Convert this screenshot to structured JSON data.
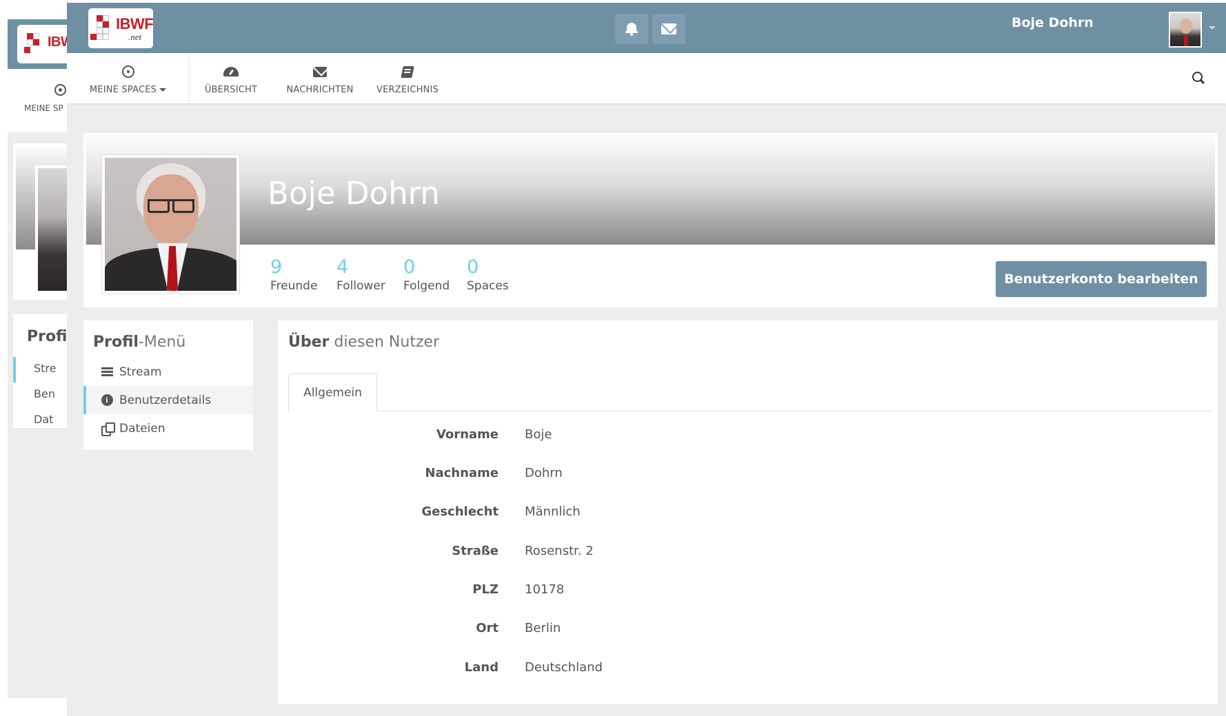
{
  "app": {
    "brand": {
      "logo_text": "IBWF",
      "logo_sub": ".net"
    },
    "colors": {
      "primary": "#6f8fa3",
      "accent": "#6fd1e5",
      "background": "#ededed"
    }
  },
  "ghost_window": {
    "nav_label": "MEINE SP",
    "menu_title": "Profil-",
    "menu_items": [
      "Stre",
      "Ben",
      "Dat"
    ]
  },
  "topbar": {
    "notifications_icon": "bell-icon",
    "messages_icon": "envelope-icon",
    "user_name": "Boje Dohrn"
  },
  "nav": {
    "items": [
      {
        "label": "MEINE SPACES",
        "icon": "target-icon",
        "dropdown": true
      },
      {
        "label": "ÜBERSICHT",
        "icon": "dashboard-icon"
      },
      {
        "label": "NACHRICHTEN",
        "icon": "envelope-icon"
      },
      {
        "label": "VERZEICHNIS",
        "icon": "book-icon"
      }
    ],
    "search_icon": "search-icon"
  },
  "profile": {
    "name": "Boje Dohrn",
    "stats": [
      {
        "value": "9",
        "label": "Freunde"
      },
      {
        "value": "4",
        "label": "Follower"
      },
      {
        "value": "0",
        "label": "Folgend"
      },
      {
        "value": "0",
        "label": "Spaces"
      }
    ],
    "edit_button": "Benutzerkonto bearbeiten"
  },
  "profile_menu": {
    "title_bold": "Profil",
    "title_light": "-Menü",
    "items": [
      {
        "label": "Stream",
        "icon": "bars-icon",
        "active": false
      },
      {
        "label": "Benutzerdetails",
        "icon": "info-icon",
        "active": true
      },
      {
        "label": "Dateien",
        "icon": "files-icon",
        "active": false
      }
    ]
  },
  "about": {
    "title_bold": "Über",
    "title_light": " diesen Nutzer",
    "tab": "Allgemein",
    "fields": [
      {
        "label": "Vorname",
        "value": "Boje"
      },
      {
        "label": "Nachname",
        "value": "Dohrn"
      },
      {
        "label": "Geschlecht",
        "value": "Männlich"
      },
      {
        "label": "Straße",
        "value": "Rosenstr. 2"
      },
      {
        "label": "PLZ",
        "value": "10178"
      },
      {
        "label": "Ort",
        "value": "Berlin"
      },
      {
        "label": "Land",
        "value": "Deutschland"
      }
    ]
  }
}
